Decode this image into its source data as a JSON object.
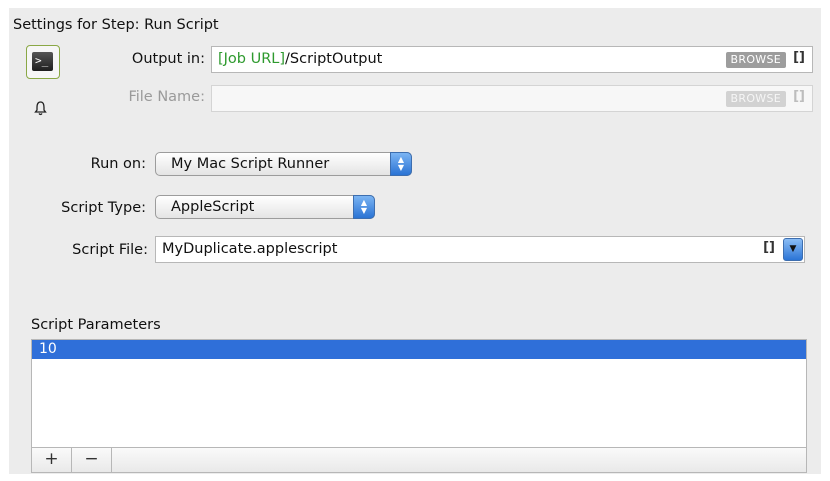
{
  "header": {
    "title": "Settings for Step: Run Script"
  },
  "icons": {
    "step": "terminal-icon",
    "step_glyph": ">_",
    "notify": "bell-icon"
  },
  "output": {
    "label": "Output in:",
    "value_var": "[Job URL]",
    "value_path": "/ScriptOutput",
    "browse": "BROWSE",
    "brackets": "[]"
  },
  "file_name": {
    "label": "File Name:",
    "value": "",
    "browse": "BROWSE",
    "brackets": "[]"
  },
  "run_on": {
    "label": "Run on:",
    "selected": "My Mac Script Runner"
  },
  "script_type": {
    "label": "Script Type:",
    "selected": "AppleScript"
  },
  "script_file": {
    "label": "Script File:",
    "value": "MyDuplicate.applescript",
    "brackets": "[]"
  },
  "params": {
    "label": "Script Parameters",
    "rows": [
      "10"
    ],
    "add": "+",
    "remove": "−"
  },
  "colors": {
    "selection": "#2f6fd9",
    "job_var": "#2e9a2e",
    "step_border": "#8aa845"
  }
}
